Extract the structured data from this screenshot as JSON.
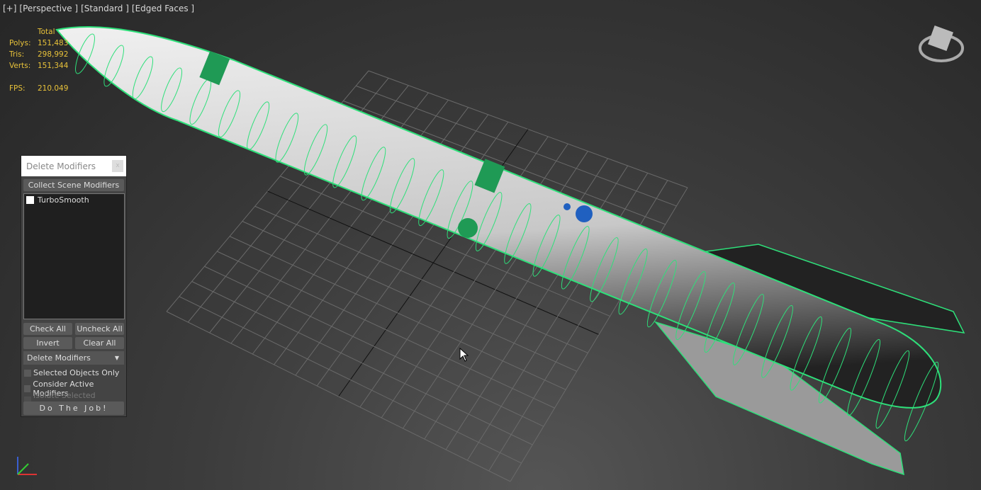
{
  "viewport_label": {
    "plus": "[+]",
    "view": "[Perspective ]",
    "shading": "[Standard ]",
    "mode": "[Edged Faces ]"
  },
  "stats": {
    "header": "Total",
    "rows": [
      {
        "k": "Polys:",
        "v": "151,483"
      },
      {
        "k": "Tris:",
        "v": "298,992"
      },
      {
        "k": "Verts:",
        "v": "151,344"
      }
    ],
    "fps_k": "FPS:",
    "fps_v": "210.049"
  },
  "dialog": {
    "title": "Delete Modifiers",
    "close": "x",
    "collect": "Collect Scene Modifiers",
    "items": [
      {
        "label": "TurboSmooth",
        "checked": false
      }
    ],
    "check_all": "Check All",
    "uncheck_all": "Uncheck All",
    "invert": "Invert",
    "clear_all": "Clear All",
    "mode": "Delete Modifiers",
    "opt1": "Selected Objects Only",
    "opt2": "Consider Active Modifiers",
    "opt3": "Isolate Selected Objects",
    "run": "Do The Job!"
  },
  "colors": {
    "wire": "#2ee07a",
    "stats": "#e8c23a",
    "body": "#d8d8d8"
  }
}
